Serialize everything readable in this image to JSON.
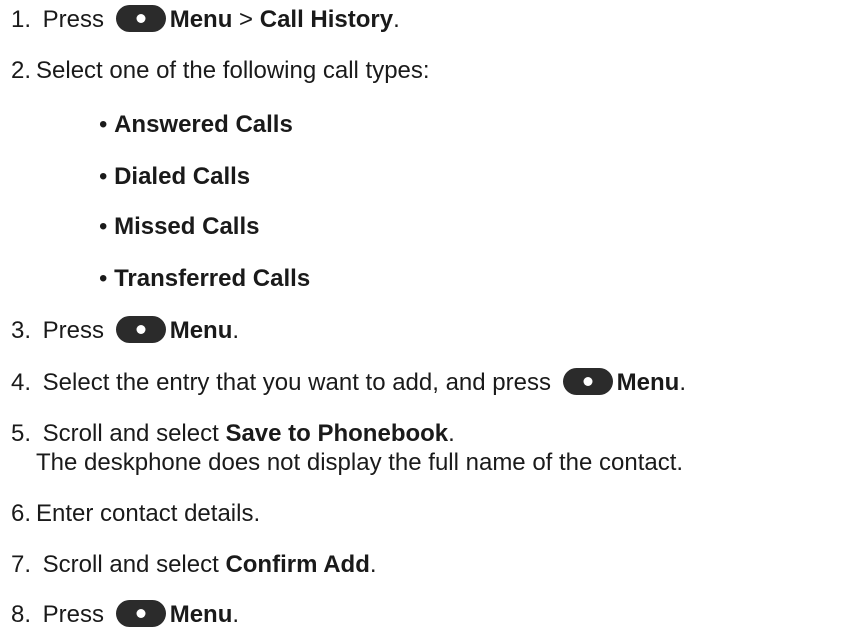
{
  "steps": [
    {
      "num": "1.",
      "pre": "Press",
      "menu": "Menu",
      "sep": ">",
      "target": "Call History",
      "end": "."
    },
    {
      "num": "2.",
      "text": "Select one of the following call types:"
    },
    {
      "num": "3.",
      "pre": "Press",
      "menu": "Menu",
      "end": "."
    },
    {
      "num": "4.",
      "pre": "Select the entry that you want to add, and press",
      "menu": "Menu",
      "end": "."
    },
    {
      "num": "5.",
      "pre": "Scroll and select",
      "target": "Save to Phonebook",
      "end": ".",
      "note": "The deskphone does not display the full name of the contact."
    },
    {
      "num": "6.",
      "text": "Enter contact details."
    },
    {
      "num": "7.",
      "pre": "Scroll and select",
      "target": "Confirm Add",
      "end": "."
    },
    {
      "num": "8.",
      "pre": "Press",
      "menu": "Menu",
      "end": "."
    }
  ],
  "call_types": [
    "Answered Calls",
    "Dialed Calls",
    "Missed Calls",
    "Transferred Calls"
  ],
  "bullet": "•",
  "icons": {
    "menu_button": "menu-button-icon"
  },
  "colors": {
    "text": "#1a1a1a",
    "button_body": "#2b2b2b",
    "button_dot": "#ffffff"
  }
}
